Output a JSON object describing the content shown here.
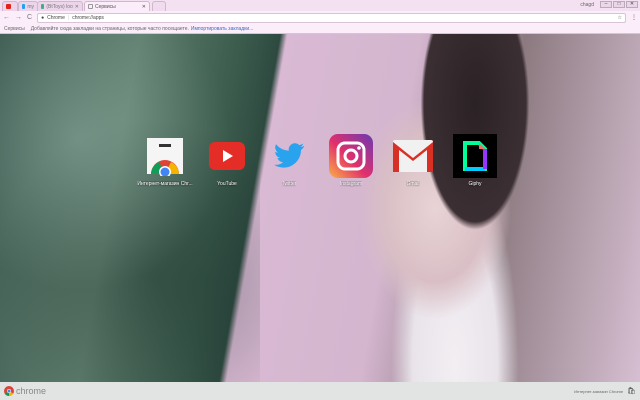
{
  "tabs": [
    {
      "label": ""
    },
    {
      "label": "my"
    },
    {
      "label": "(BtToys) loo"
    },
    {
      "label": "Сервисы",
      "active": true
    }
  ],
  "window": {
    "user": "сhagd",
    "min": "–",
    "max": "□",
    "close": "✕"
  },
  "toolbar": {
    "back": "←",
    "forward": "→",
    "reload": "C",
    "site": "Chrome",
    "url": "chrome://apps",
    "star": "☆",
    "menu": "⋮"
  },
  "bookmarks": {
    "apps": "Сервисы",
    "hint": "Добавляйте сюда закладки на страницы, которые часто посещаете.",
    "import": "Импортировать закладки..."
  },
  "apps": [
    {
      "label": "Интернет-магазин Chr..."
    },
    {
      "label": "YouTube"
    },
    {
      "label": "Twitter"
    },
    {
      "label": "Instagram"
    },
    {
      "label": "Gmail"
    },
    {
      "label": "Giphy"
    }
  ],
  "bottom": {
    "logo": "chrome",
    "store": "Интернет-магазин Chrome"
  }
}
